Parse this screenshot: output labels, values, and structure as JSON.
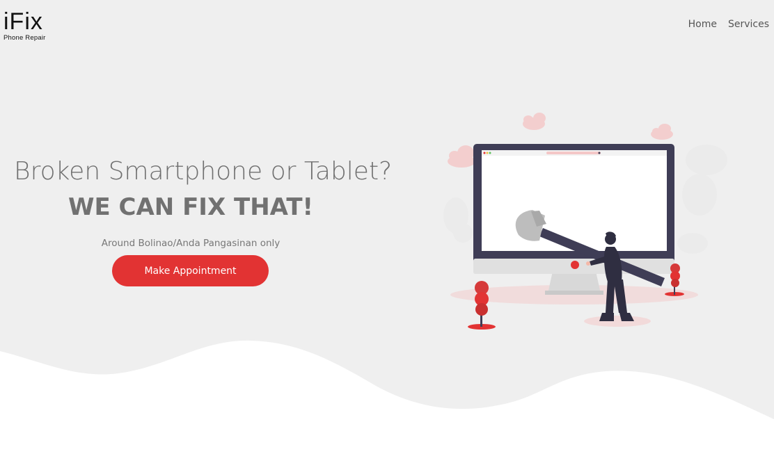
{
  "brand": {
    "name": "iFix",
    "tagline": "Phone Repair"
  },
  "nav": {
    "items": [
      "Home",
      "Services"
    ]
  },
  "hero": {
    "line1": "Broken Smartphone or Tablet?",
    "line2": "WE CAN FIX THAT!",
    "subtitle": "Around Bolinao/Anda Pangasinan only",
    "cta_label": "Make Appointment"
  },
  "colors": {
    "accent": "#e23333",
    "background": "#efefef",
    "monitor_frame": "#3f3d56"
  },
  "illustration": {
    "icon": "repair-person-hammer-monitor-illustration"
  }
}
